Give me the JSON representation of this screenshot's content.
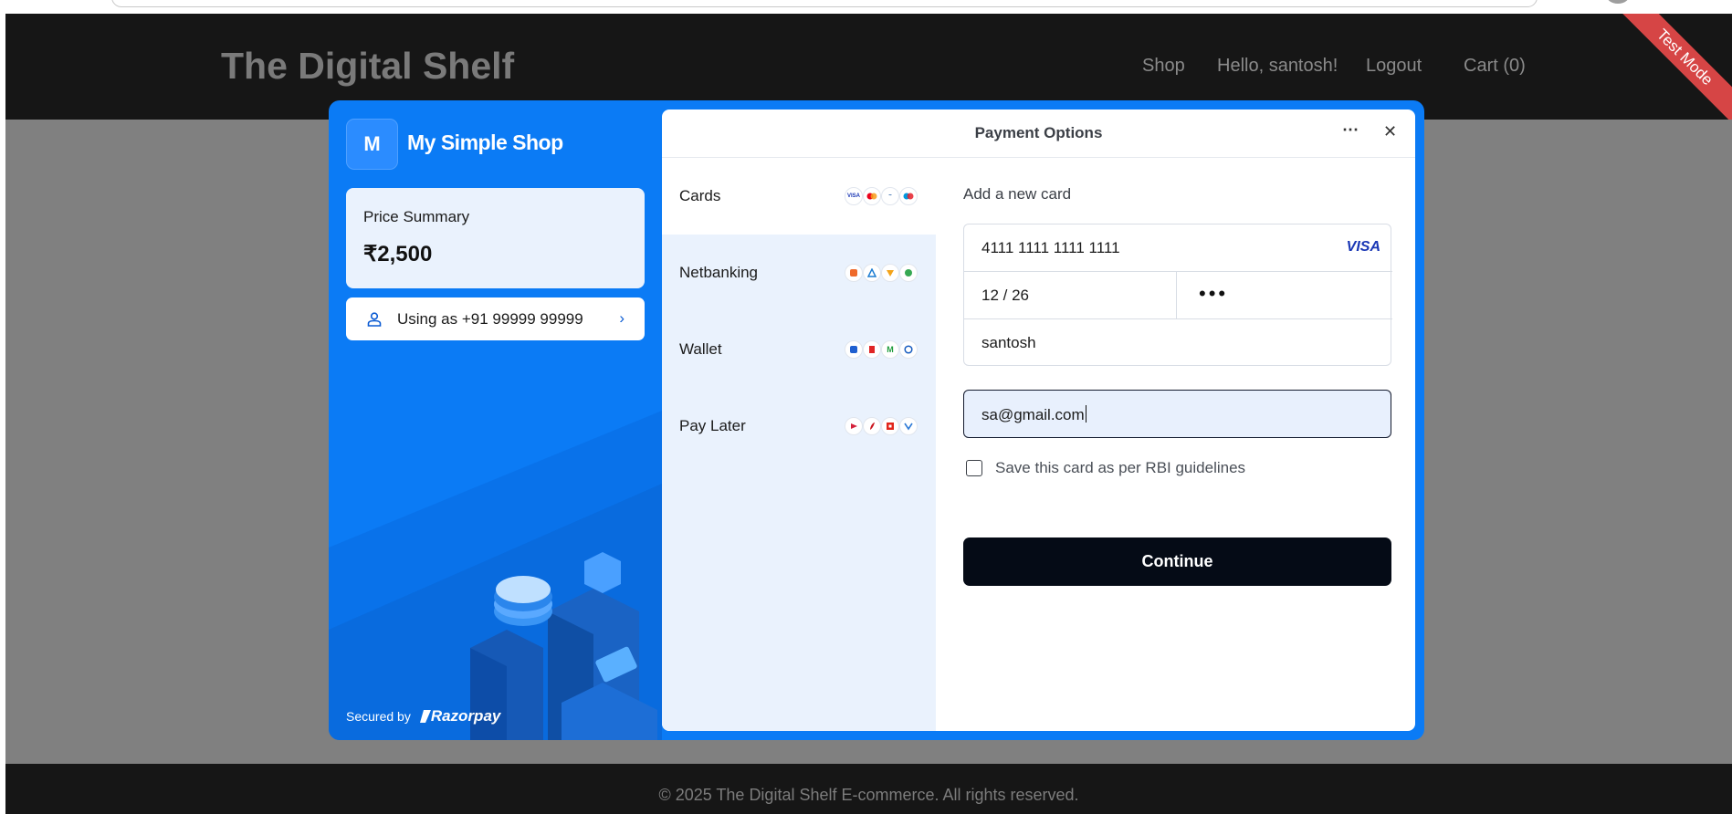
{
  "site": {
    "logo": "The Digital Shelf",
    "nav": {
      "shop": "Shop",
      "greeting": "Hello, santosh!",
      "logout": "Logout",
      "cart": "Cart (0)"
    },
    "ribbon": "Test Mode",
    "footer": "© 2025 The Digital Shelf E-commerce. All rights reserved.",
    "colors": {
      "header_bg": "#161616",
      "overlay_bg": "#808080",
      "ribbon": "#d64545"
    }
  },
  "checkout": {
    "brand_initial": "M",
    "brand_name": "My Simple Shop",
    "price_summary_label": "Price Summary",
    "price_value": "₹2,500",
    "user_label": "Using as +91 99999 99999",
    "secured_by": "Secured by",
    "provider": "Razorpay",
    "colors": {
      "accent": "#0b7bf5",
      "button": "#050b16",
      "methods_bg": "#eaf2fd"
    }
  },
  "payment": {
    "title": "Payment Options",
    "more_icon": "more-horizontal-icon",
    "close_icon": "close-icon",
    "methods": [
      {
        "label": "Cards",
        "icons": [
          "VISA",
          "MC",
          "RuPay",
          "Maestro"
        ]
      },
      {
        "label": "Netbanking",
        "icons": [
          "bank-1",
          "bank-2",
          "bank-3",
          "bank-4"
        ]
      },
      {
        "label": "Wallet",
        "icons": [
          "wallet-1",
          "wallet-2",
          "wallet-3",
          "wallet-4"
        ]
      },
      {
        "label": "Pay Later",
        "icons": [
          "paylater-1",
          "paylater-2",
          "paylater-3",
          "paylater-4"
        ]
      }
    ],
    "selected_method": "Cards",
    "form": {
      "heading": "Add a new card",
      "card_number": "4111 1111 1111 1111",
      "card_brand": "VISA",
      "expiry": "12 / 26",
      "cvv_masked": "•••",
      "name": "santosh",
      "email": "sa@gmail.com",
      "save_card_label": "Save this card as per RBI guidelines",
      "save_card_checked": false,
      "continue_label": "Continue"
    }
  }
}
